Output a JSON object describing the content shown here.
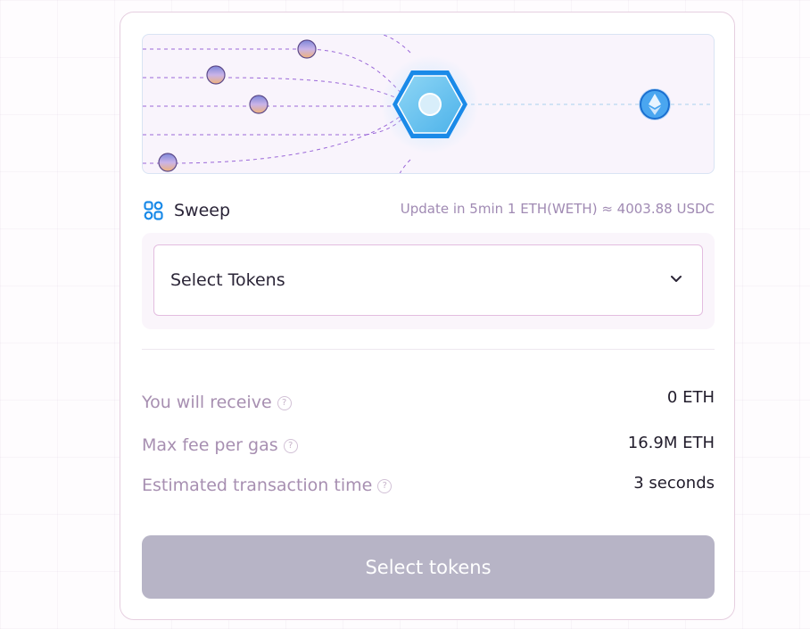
{
  "swap": {
    "mode_label": "Sweep",
    "mode_icon": "sweep-icon",
    "rate_text": "Update in 5min 1 ETH(WETH) ≈ 4003.88 USDC",
    "token_select": {
      "label": "Select Tokens",
      "icon": "chevron-down-icon"
    }
  },
  "summary": [
    {
      "label": "You will receive",
      "value": "0 ETH"
    },
    {
      "label": "Max fee per gas",
      "value": "16.9M ETH"
    },
    {
      "label": "Estimated transaction time",
      "value": "3 seconds"
    }
  ],
  "submit": {
    "label": "Select tokens"
  },
  "colors": {
    "accent_blue": "#1a8ae8",
    "label_purple": "#a78fb1",
    "button_disabled": "#b7b4c6",
    "card_border": "#e6cfe0"
  }
}
